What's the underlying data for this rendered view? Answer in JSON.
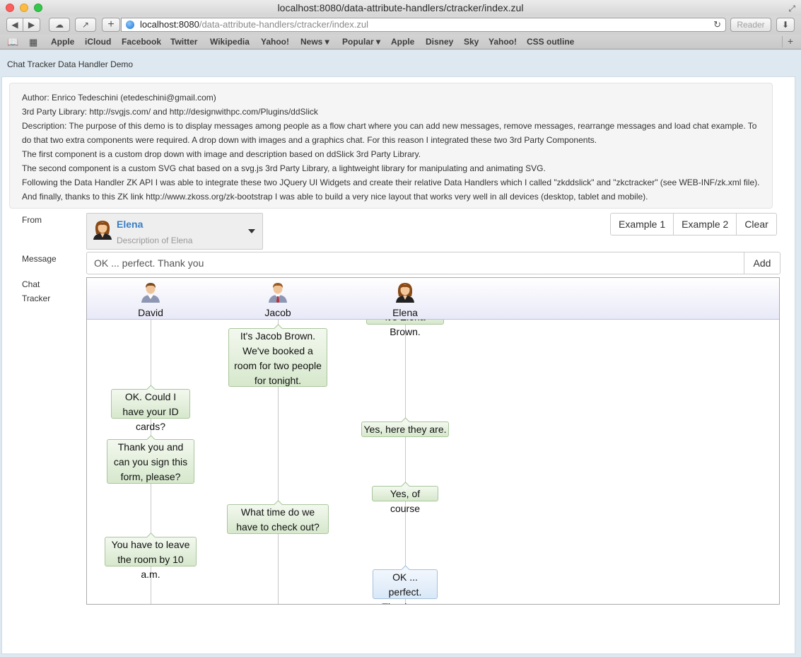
{
  "window": {
    "title": "localhost:8080/data-attribute-handlers/ctracker/index.zul"
  },
  "toolbar": {
    "url_host": "localhost:8080",
    "url_path": "/data-attribute-handlers/ctracker/index.zul",
    "reader_label": "Reader"
  },
  "bookmarks": [
    "Apple",
    "iCloud",
    "Facebook",
    "Twitter",
    "Wikipedia",
    "Yahoo!",
    "News ▾",
    "Popular ▾",
    "Apple",
    "Disney",
    "Sky",
    "Yahoo!",
    "CSS outline"
  ],
  "page": {
    "title": "Chat Tracker Data Handler Demo",
    "description": [
      "Author: Enrico Tedeschini (etedeschini@gmail.com)",
      "3rd Party Library: http://svgjs.com/ and http://designwithpc.com/Plugins/ddSlick",
      "Description: The purpose of this demo is to display messages among people as a flow chart where you can add new messages, remove messages, rearrange messages and load chat example. To",
      "do that two extra components were required. A drop down with images and a graphics chat. For this reason I integrated these two 3rd Party Components.",
      "The first component is a custom drop down with image and description based on ddSlick 3rd Party Library.",
      "The second component is a custom SVG chat based on a svg.js 3rd Party Library, a lightweight library for manipulating and animating SVG.",
      "Following the Data Handler ZK API I was able to integrate these two JQuery UI Widgets and create their relative Data Handlers which I called \"zkddslick\" and \"zkctracker\" (see WEB-INF/zk.xml file).",
      "And finally, thanks to this ZK link http://www.zkoss.org/zk-bootstrap I was able to build a very nice layout that works very well in all devices (desktop, tablet and mobile)."
    ]
  },
  "form": {
    "from_label": "From",
    "message_label": "Message",
    "tracker_label_1": "Chat",
    "tracker_label_2": "Tracker",
    "from_selected": {
      "name": "Elena",
      "description": "Description of Elena"
    },
    "message_value": "OK ... perfect. Thank you",
    "add_label": "Add",
    "buttons": [
      "Example 1",
      "Example 2",
      "Clear"
    ]
  },
  "tracker": {
    "people": [
      "David",
      "Jacob",
      "Elena"
    ],
    "messages": [
      {
        "from": "Elena",
        "text": "It's Elena Brown."
      },
      {
        "from": "Jacob",
        "text": "It's Jacob Brown. We've booked a room for two people for tonight."
      },
      {
        "from": "David",
        "text": "OK. Could I have your ID cards?"
      },
      {
        "from": "Elena",
        "text": "Yes, here they are."
      },
      {
        "from": "David",
        "text": "Thank you and can you sign this form, please?"
      },
      {
        "from": "Elena",
        "text": "Yes, of course"
      },
      {
        "from": "Jacob",
        "text": "What time do we have to check out?"
      },
      {
        "from": "David",
        "text": "You have to leave the room by 10 a.m."
      },
      {
        "from": "Elena",
        "text": "OK ... perfect. Thank you"
      }
    ]
  }
}
